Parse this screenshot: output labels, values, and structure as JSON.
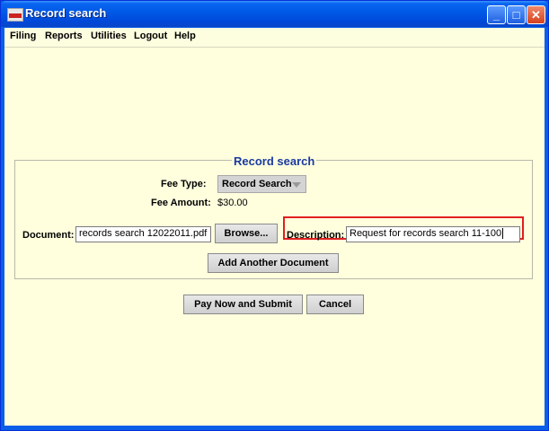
{
  "window": {
    "title": "Record search",
    "min_label": "_",
    "max_label": "□",
    "close_label": "✕"
  },
  "menu": [
    "Filing",
    "Reports",
    "Utilities",
    "Logout",
    "Help"
  ],
  "panel": {
    "title": "Record search",
    "fee_type_label": "Fee Type:",
    "fee_type_value": "Record Search",
    "fee_amount_label": "Fee Amount:",
    "fee_amount_value": "$30.00",
    "document_label": "Document:",
    "document_value": "records search 12022011.pdf",
    "browse_label": "Browse...",
    "description_label": "Description:",
    "description_value": "Request for records search 11-100",
    "add_document_label": "Add Another Document"
  },
  "actions": {
    "pay_label": "Pay Now and Submit",
    "cancel_label": "Cancel"
  },
  "colors": {
    "titlebar": "#0058e6",
    "content_bg": "#ffffde",
    "legend": "#1a3aa0",
    "highlight": "#e02020"
  },
  "icons": {
    "app": "app-icon",
    "minimize": "minimize-icon",
    "maximize": "maximize-icon",
    "close": "close-icon",
    "combo": "chevron-down-icon"
  }
}
